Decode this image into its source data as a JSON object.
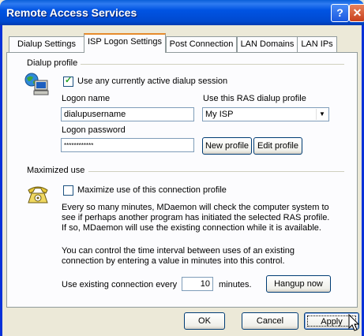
{
  "window": {
    "title": "Remote Access Services",
    "help_button": "?",
    "close_button": "✕"
  },
  "tabs": [
    {
      "label": "Dialup Settings",
      "active": false
    },
    {
      "label": "ISP Logon Settings",
      "active": true
    },
    {
      "label": "Post Connection",
      "active": false
    },
    {
      "label": "LAN Domains",
      "active": false
    },
    {
      "label": "LAN IPs",
      "active": false
    }
  ],
  "dialup_profile": {
    "group_label": "Dialup profile",
    "use_active_session_label": "Use any currently active dialup session",
    "use_active_session_checked": true,
    "logon_name_label": "Logon name",
    "logon_name_value": "dialupusername",
    "ras_profile_label": "Use this RAS dialup profile",
    "ras_profile_value": "My ISP",
    "logon_password_label": "Logon password",
    "logon_password_value": "************",
    "new_profile_button": "New profile",
    "edit_profile_button": "Edit profile"
  },
  "maximized_use": {
    "group_label": "Maximized use",
    "maximize_label": "Maximize use of this connection profile",
    "maximize_checked": false,
    "description_lines": [
      "Every so many minutes, MDaemon will check the computer system to",
      "see if perhaps another program has initiated the selected RAS profile.",
      "If so, MDaemon will use the existing connection while it is available."
    ],
    "interval_lines": [
      "You can control the time interval between uses of an existing",
      "connection by entering a value in minutes into this control."
    ],
    "interval_label": "Use existing connection every",
    "interval_value": "10",
    "interval_unit": "minutes.",
    "hangup_button": "Hangup now"
  },
  "footer": {
    "ok_button": "OK",
    "cancel_button": "Cancel",
    "apply_button": "Apply"
  },
  "colors": {
    "titlebar": "#0054e3",
    "dialog_bg": "#ece9d8",
    "active_tab_accent": "#e68b2c"
  }
}
